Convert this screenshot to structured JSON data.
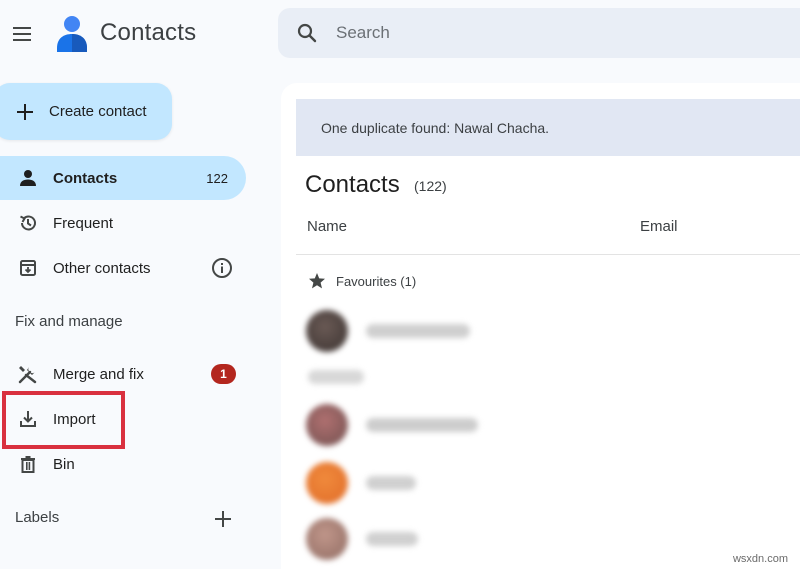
{
  "app": {
    "title": "Contacts"
  },
  "search": {
    "placeholder": "Search"
  },
  "sidebar": {
    "create_label": "Create contact",
    "items": [
      {
        "label": "Contacts",
        "count": "122",
        "icon": "person-icon"
      },
      {
        "label": "Frequent",
        "icon": "history-icon"
      },
      {
        "label": "Other contacts",
        "icon": "download-box-icon"
      }
    ],
    "fix_manage_heading": "Fix and manage",
    "fix_items": [
      {
        "label": "Merge and fix",
        "badge": "1",
        "icon": "tools-icon"
      },
      {
        "label": "Import",
        "icon": "import-icon"
      },
      {
        "label": "Bin",
        "icon": "trash-icon"
      }
    ],
    "labels_heading": "Labels"
  },
  "main": {
    "banner": "One duplicate found: Nawal Chacha.",
    "list_title": "Contacts",
    "list_count": "(122)",
    "columns": [
      "Name",
      "Email"
    ],
    "favourites_label": "Favourites (1)"
  },
  "colors": {
    "accent": "#c2e7ff",
    "badge": "#b3261e",
    "highlight": "#d9303f",
    "banner": "#e1e7f3"
  },
  "watermark": "wsxdn.com"
}
